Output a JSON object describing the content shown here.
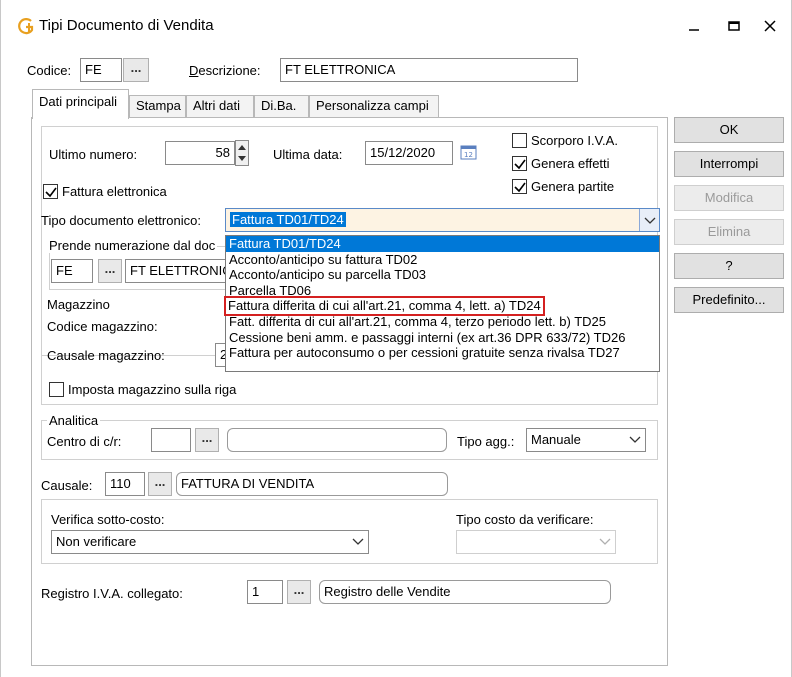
{
  "window": {
    "title": "Tipi Documento di Vendita"
  },
  "header": {
    "codice_label": "Codice:",
    "codice_value": "FE",
    "descrizione_label": "Descrizione:",
    "descrizione_value": "FT ELETTRONICA"
  },
  "tabs": [
    {
      "label": "Dati principali"
    },
    {
      "label": "Stampa"
    },
    {
      "label": "Altri dati"
    },
    {
      "label": "Di.Ba."
    },
    {
      "label": "Personalizza campi"
    }
  ],
  "main": {
    "ultimo_numero_label": "Ultimo numero:",
    "ultimo_numero_value": "58",
    "ultima_data_label": "Ultima data:",
    "ultima_data_value": "15/12/2020",
    "scorporo_label": "Scorporo I.V.A.",
    "genera_effetti_label": "Genera effetti",
    "genera_partite_label": "Genera partite",
    "fattura_elettronica_label": "Fattura elettronica",
    "tipo_doc_label": "Tipo documento elettronico:",
    "tipo_doc_value": "Fattura TD01/TD24",
    "prende_num_label": "Prende numerazione dal doc",
    "prende_code": "FE",
    "prende_desc": "FT ELETTRONIC",
    "magazzino_title": "Magazzino",
    "codice_magazzino_label": "Codice magazzino:",
    "causale_magazzino_label": "Causale magazzino:",
    "causale_magazzino_value": "2",
    "imposta_magazzino_label": "Imposta magazzino sulla riga",
    "analitica_title": "Analitica",
    "centro_label": "Centro di c/r:",
    "centro_value": "",
    "tipo_agg_label": "Tipo agg.:",
    "tipo_agg_value": "Manuale",
    "causale_label": "Causale:",
    "causale_code": "110",
    "causale_desc": "FATTURA DI VENDITA",
    "verifica_label": "Verifica sotto-costo:",
    "verifica_value": "Non verificare",
    "tipo_costo_label": "Tipo costo da verificare:",
    "tipo_costo_value": "",
    "registro_label": "Registro I.V.A. collegato:",
    "registro_code": "1",
    "registro_desc": "Registro delle Vendite",
    "dots": "..."
  },
  "dropdown": {
    "items": [
      "Fattura TD01/TD24",
      "Acconto/anticipo su fattura TD02",
      "Acconto/anticipo su parcella TD03",
      "Parcella TD06",
      "Fattura differita di cui all'art.21, comma 4, lett. a) TD24",
      "Fatt. differita di cui all'art.21, comma 4, terzo periodo lett. b) TD25",
      "Cessione beni amm. e passaggi interni (ex art.36 DPR 633/72) TD26",
      "Fattura per autoconsumo o per cessioni gratuite senza rivalsa TD27"
    ]
  },
  "sidebar": {
    "ok": "OK",
    "interrompi": "Interrompi",
    "modifica": "Modifica",
    "elimina": "Elimina",
    "help": "?",
    "predefinito": "Predefinito..."
  },
  "colors": {
    "accent": "#0078d7",
    "highlight_border": "#d42020",
    "app_icon": "#e8a020"
  }
}
